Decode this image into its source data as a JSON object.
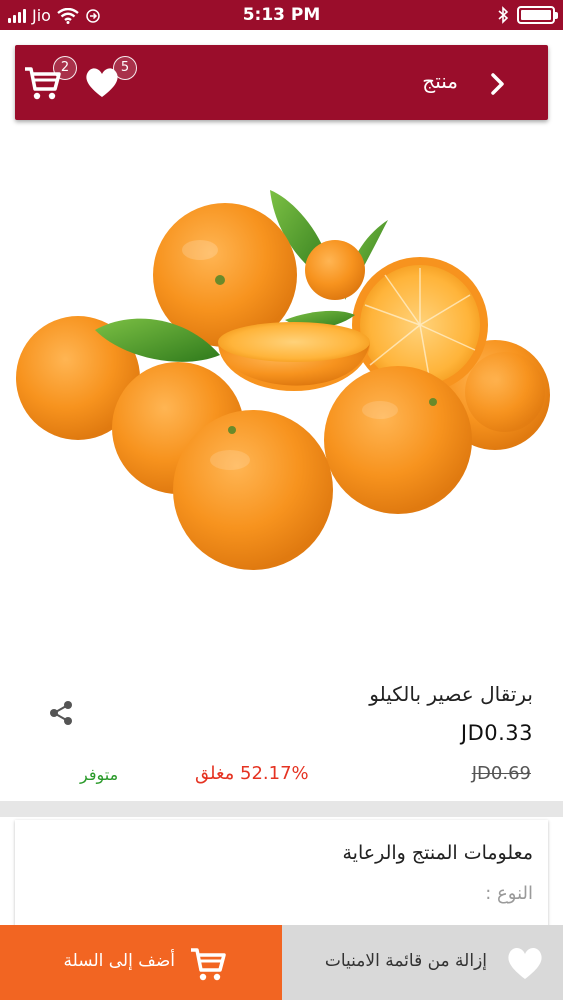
{
  "status_bar": {
    "carrier": "Jio",
    "time": "5:13 PM"
  },
  "header": {
    "title": "منتج",
    "cart_count": "2",
    "wishlist_count": "5"
  },
  "product": {
    "name": "برتقال عصير بالكيلو",
    "price": "JD0.33",
    "old_price": "JD0.69",
    "discount": "52.17% مغلق",
    "availability": "متوفر"
  },
  "info_card": {
    "title": "معلومات المنتج والرعاية",
    "type_label": "النوع :"
  },
  "bottom_bar": {
    "add_to_cart_label": "أضف إلى السلة",
    "remove_wishlist_label": "إزالة من قائمة الامنيات"
  },
  "colors": {
    "brand": "#9a0d2b",
    "accent": "#f26522",
    "discount": "#e53322",
    "available": "#2a9a2a"
  },
  "icons": [
    "cart-icon",
    "heart-icon",
    "chevron-right-icon",
    "share-icon",
    "wifi-icon",
    "bluetooth-icon",
    "battery-icon"
  ]
}
